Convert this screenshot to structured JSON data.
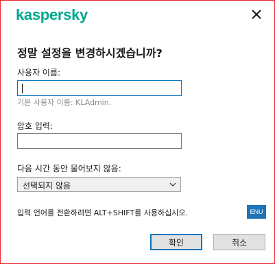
{
  "brand": {
    "name": "kaspersky",
    "color": "#00a88e"
  },
  "dialog": {
    "title": "정말 설정을 변경하시겠습니까?",
    "close_icon": "close-icon"
  },
  "username": {
    "label": "사용자 이름:",
    "value": "",
    "hint": "기본 사용자 이름: KLAdmin."
  },
  "password": {
    "label": "암호 입력:",
    "value": ""
  },
  "remember": {
    "label": "다음 시간 동안 물어보지 않음:",
    "selected": "선택되지 않음"
  },
  "footnote": "입력 언어를 전환하려면 ALT+SHIFT를 사용하십시오.",
  "language_indicator": "ENU",
  "buttons": {
    "ok": "확인",
    "cancel": "취소"
  }
}
